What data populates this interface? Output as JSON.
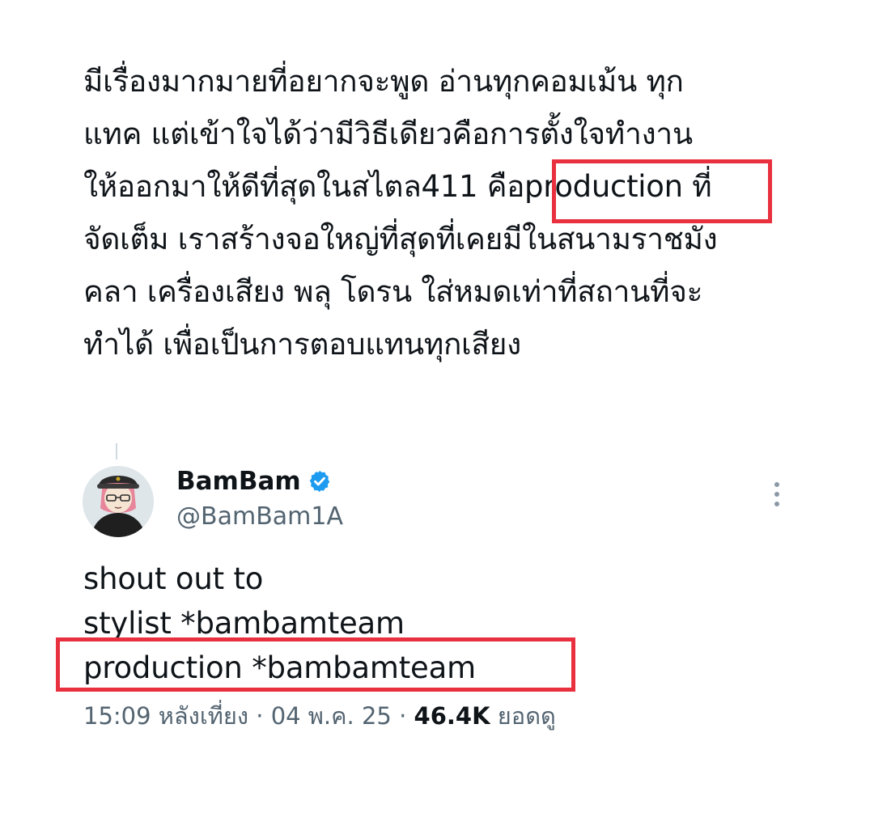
{
  "post_text_lines": [
    "มีเรื่องมากมายที่อยากจะพูด อ่านทุกคอมเม้น ทุก",
    "แทค แต่เข้าใจได้ว่ามีวิธีเดียวคือการตั้งใจทำงาน",
    "ให้ออกมาให้ดีที่สุดในสไตล411 คือproduction ที่",
    "จัดเต็ม เราสร้างจอใหญ่ที่สุดที่เคยมีในสนามราชมัง",
    "คลา เครื่องเสียง พลุ โดรน ใส่หมดเท่าที่สถานที่จะ",
    "ทำได้ เพื่อเป็นการตอบแทนทุกเสียง"
  ],
  "reply": {
    "display_name": "BamBam",
    "handle": "@BamBam1A",
    "verified": true,
    "avatar_icon": "avatar-illustration",
    "body_lines": [
      "shout out to",
      "stylist *bambamteam",
      "production *bambamteam"
    ],
    "time": "15:09 หลังเที่ยง",
    "separator": "·",
    "date": "04 พ.ค. 25",
    "views_count": "46.4K",
    "views_label": "ยอดดู"
  },
  "colors": {
    "text": "#0f1419",
    "secondary": "#536471",
    "verified": "#1d9bf0",
    "highlight": "#e8303f"
  },
  "icons": [
    "verified-badge-icon",
    "more-options-icon"
  ]
}
